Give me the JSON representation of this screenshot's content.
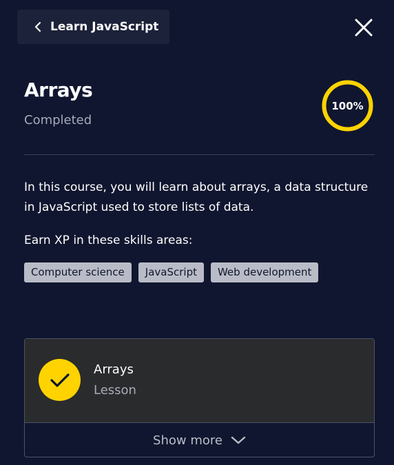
{
  "header": {
    "back_label": "Learn JavaScript",
    "back_icon": "chevron-left-icon",
    "close_icon": "close-icon"
  },
  "course": {
    "title": "Arrays",
    "status": "Completed",
    "progress_percent": 100,
    "progress_label": "100%",
    "description": "In this course, you will learn about arrays, a data structure in JavaScript used to store lists of data.",
    "skills_heading": "Earn XP in these skills areas:",
    "skills": [
      "Computer science",
      "JavaScript",
      "Web development"
    ]
  },
  "lesson": {
    "title": "Arrays",
    "type": "Lesson",
    "completed": true,
    "check_icon": "checkmark-icon"
  },
  "footer": {
    "show_more_label": "Show more",
    "show_more_icon": "chevron-down-icon"
  },
  "colors": {
    "background": "#10162f",
    "accent": "#ffd300",
    "muted_text": "#a7aab8",
    "tag_background": "#b9bcc6",
    "card_background": "#2a2b2d"
  }
}
